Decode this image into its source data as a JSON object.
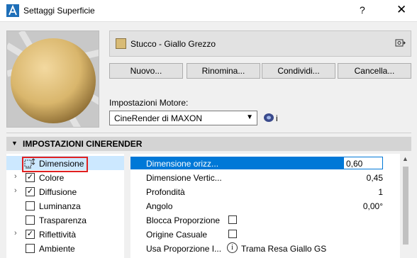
{
  "window": {
    "title": "Settaggi Superficie",
    "help_label": "?",
    "close_label": "✕"
  },
  "material": {
    "name": "Stucco - Giallo Grezzo",
    "swatch_color": "#d8bb76"
  },
  "buttons": {
    "new": "Nuovo...",
    "rename": "Rinomina...",
    "share": "Condividi...",
    "delete": "Cancella..."
  },
  "engine": {
    "label": "Impostazioni Motore:",
    "value": "CineRender di MAXON",
    "info_label": "i"
  },
  "panel": {
    "title": "IMPOSTAZIONI CINERENDER"
  },
  "channels": [
    {
      "label": "Dimensione",
      "checked": false,
      "expandable": false,
      "selected": true
    },
    {
      "label": "Colore",
      "checked": true,
      "expandable": true
    },
    {
      "label": "Diffusione",
      "checked": true,
      "expandable": true
    },
    {
      "label": "Luminanza",
      "checked": false,
      "expandable": false
    },
    {
      "label": "Trasparenza",
      "checked": false,
      "expandable": false
    },
    {
      "label": "Riflettività",
      "checked": true,
      "expandable": true
    },
    {
      "label": "Ambiente",
      "checked": false,
      "expandable": false
    }
  ],
  "properties": [
    {
      "key": "Dimensione orizz...",
      "value": "0,60",
      "selected": true
    },
    {
      "key": "Dimensione Vertic...",
      "value": "0,45"
    },
    {
      "key": "Profondità",
      "value": "1"
    },
    {
      "key": "Angolo",
      "value": "0,00°"
    },
    {
      "key": "Blocca Proporzione",
      "value": ""
    },
    {
      "key": "Origine Casuale",
      "value": ""
    },
    {
      "key": "Usa Proporzione I...",
      "value": "Trama Resa Giallo GS"
    }
  ],
  "icons": {
    "app": "archicad-icon",
    "help": "help-icon",
    "close": "close-icon",
    "material_menu": "material-menu-icon",
    "engine_info": "engine-info-icon",
    "dimension": "dimension-icon"
  }
}
